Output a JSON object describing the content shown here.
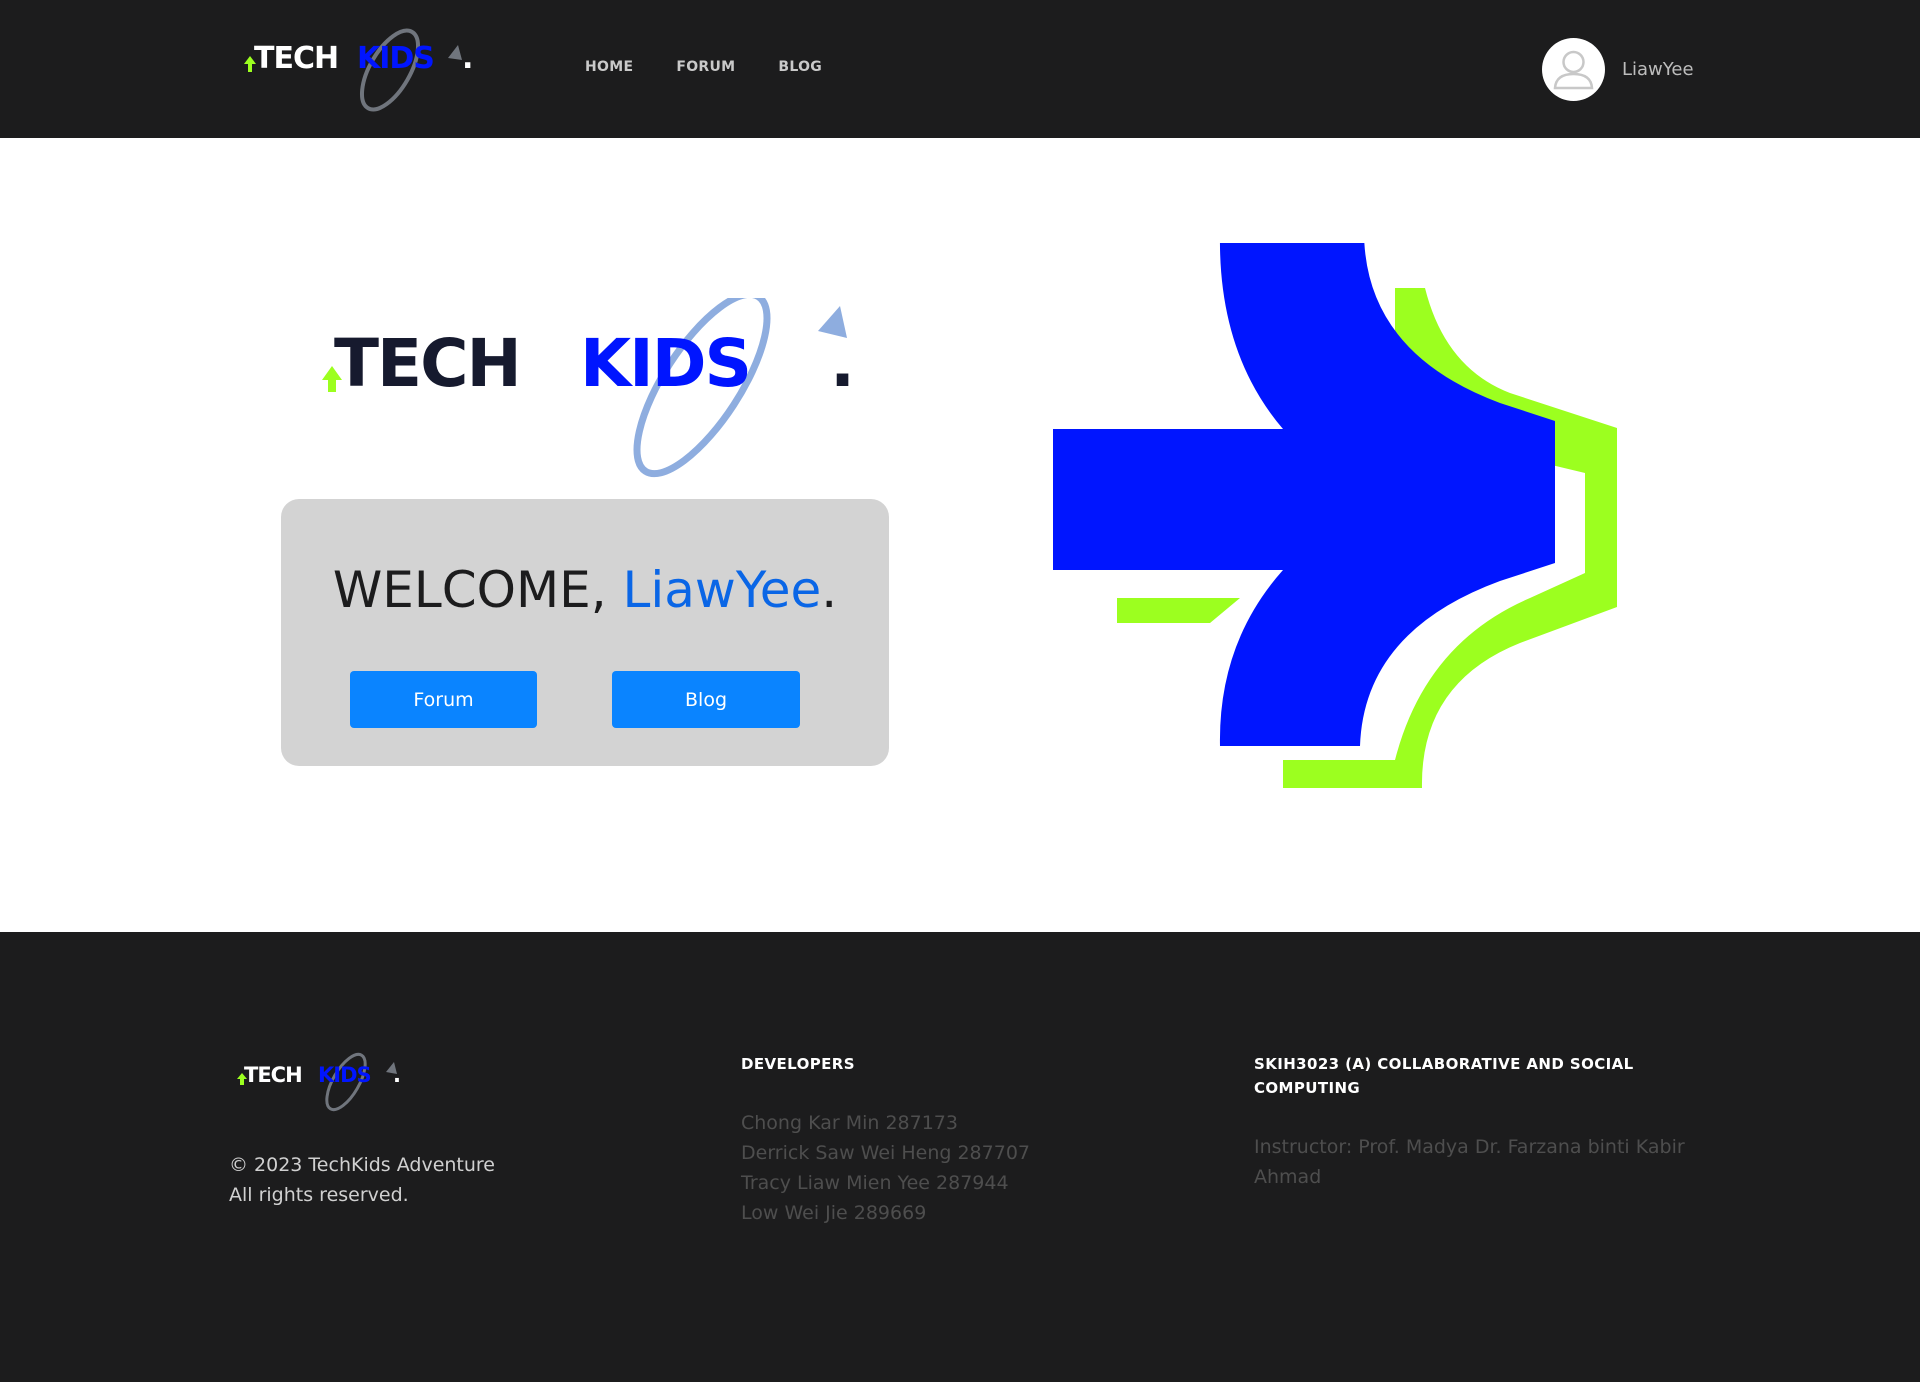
{
  "brand": {
    "logo_prefix": "TECH",
    "logo_suffix": "KIDS",
    "logo_dot": ".",
    "colors": {
      "blue": "#0015ff",
      "green": "#9cff1f",
      "orbit": "#8eaddf",
      "button": "#0a84ff",
      "name": "#0a66e6"
    }
  },
  "nav": {
    "items": [
      "HOME",
      "FORUM",
      "BLOG"
    ]
  },
  "user": {
    "name": "LiawYee",
    "avatar_icon": "user-avatar-icon"
  },
  "hero": {
    "welcome_prefix": "WELCOME, ",
    "welcome_name": "LiawYee",
    "welcome_suffix": ".",
    "forum_button": "Forum",
    "blog_button": "Blog",
    "arrow_icon": "arrow-right-icon"
  },
  "footer": {
    "copyright_line1": "© 2023 TechKids Adventure",
    "copyright_line2": "All rights reserved.",
    "developers_title": "DEVELOPERS",
    "developers": [
      "Chong Kar Min 287173",
      "Derrick Saw Wei Heng 287707",
      "Tracy Liaw Mien Yee 287944",
      "Low Wei Jie 289669"
    ],
    "course_title": "SKIH3023 (A) COLLABORATIVE AND SOCIAL COMPUTING",
    "instructor": "Instructor: Prof. Madya Dr. Farzana binti Kabir Ahmad"
  }
}
